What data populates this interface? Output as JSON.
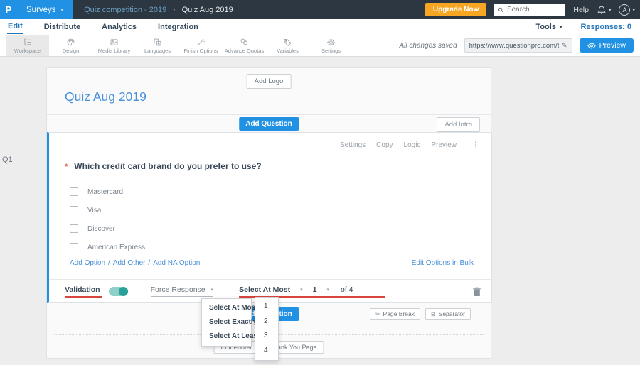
{
  "topbar": {
    "logo": "P",
    "app_menu": "Surveys",
    "breadcrumb_parent": "Quiz competition - 2019",
    "breadcrumb_current": "Quiz Aug 2019",
    "upgrade_label": "Upgrade Now",
    "search_placeholder": "Search",
    "help_label": "Help",
    "avatar_initial": "A"
  },
  "nav": {
    "items": [
      "Edit",
      "Distribute",
      "Analytics",
      "Integration"
    ],
    "active": "Edit",
    "tools_label": "Tools",
    "responses_label": "Responses: 0"
  },
  "toolbar": {
    "items": [
      "Workspace",
      "Design",
      "Media Library",
      "Languages",
      "Finish Options",
      "Advance Quotas",
      "Variables",
      "Settings"
    ],
    "active": "Workspace",
    "saved_label": "All changes saved",
    "url_value": "https://www.questionpro.com/t/APNrFZ",
    "preview_label": "Preview"
  },
  "survey": {
    "add_logo_label": "Add Logo",
    "title": "Quiz Aug 2019",
    "add_question_label": "Add Question",
    "add_intro_label": "Add Intro",
    "question_index": "Q1",
    "question": {
      "actions": [
        "Settings",
        "Copy",
        "Logic",
        "Preview"
      ],
      "required_marker": "*",
      "text": "Which credit card brand do you prefer to use?",
      "options": [
        "Mastercard",
        "Visa",
        "Discover",
        "American Express"
      ],
      "option_links": [
        "Add Option",
        "Add Other",
        "Add NA Option"
      ],
      "bulk_edit_label": "Edit Options in Bulk"
    },
    "validation": {
      "label": "Validation",
      "force_response_label": "Force Response",
      "rule_value": "Select At Most",
      "count_value": "1",
      "of_label": "of 4"
    },
    "footer": {
      "add_question_label": "Add Question",
      "page_break_label": "Page Break",
      "separator_label": "Separator",
      "edit_footer_label": "Edit Footer",
      "thank_you_label": "Thank You Page"
    }
  },
  "dropdowns": {
    "rule_options": [
      "Select At Most",
      "Select Exactly",
      "Select At Least"
    ],
    "count_options": [
      "1",
      "2",
      "3",
      "4"
    ]
  },
  "icons": {
    "caret": "▾",
    "breadcrumb_sep": "›",
    "ellipsis": "⋮",
    "pencil": "✎",
    "slash": "/",
    "page_break": "✂",
    "separator": "⊟"
  },
  "colors": {
    "accent_blue": "#2191e4",
    "dark_bar": "#2d3741",
    "orange": "#f6a622",
    "teal": "#2aa198",
    "red_underline": "#d9453c",
    "link_blue": "#4a90d9"
  }
}
